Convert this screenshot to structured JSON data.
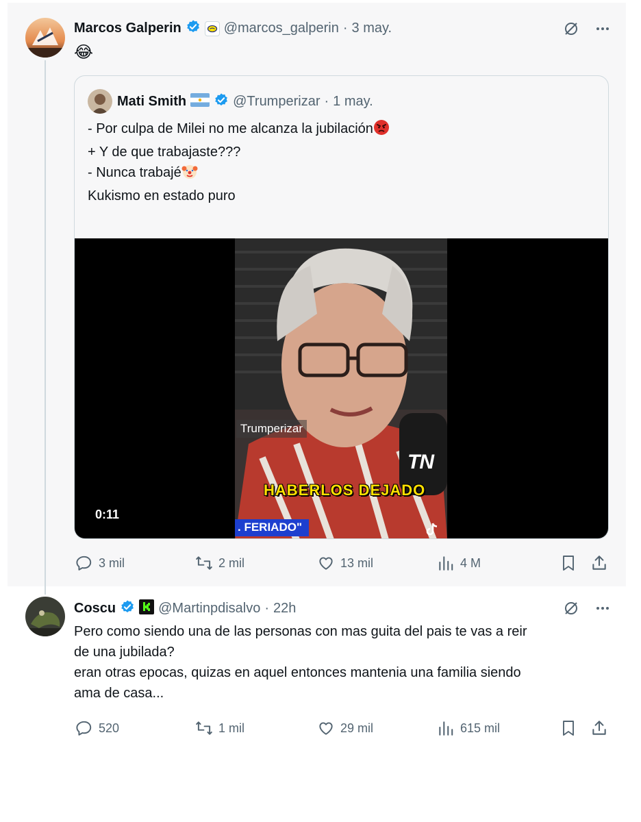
{
  "post": {
    "author": {
      "name": "Marcos Galperin",
      "handle": "@marcos_galperin",
      "time": "3 may."
    },
    "body_emoji": "😂",
    "quote": {
      "author": {
        "name": "Mati Smith",
        "handle": "@Trumperizar",
        "time": "1 may."
      },
      "lines": [
        "- Por culpa de Milei no me alcanza la jubilación",
        "+ Y de que trabajaste???",
        "- Nunca trabajé",
        "",
        "Kukismo en estado puro"
      ],
      "video": {
        "duration": "0:11",
        "watermark": "Trumperizar",
        "caption": "HABERLOS DEJADO",
        "ticker": ". FERIADO\"",
        "channel": "TN"
      }
    },
    "stats": {
      "replies": "3 mil",
      "reposts": "2 mil",
      "likes": "13 mil",
      "views": "4 M"
    }
  },
  "reply": {
    "author": {
      "name": "Coscu",
      "handle": "@Martinpdisalvo",
      "time": "22h"
    },
    "lines": [
      "Pero como siendo una de las personas con mas guita del pais te vas a reir",
      "de una jubilada?",
      "eran otras epocas, quizas en aquel entonces mantenia una familia siendo",
      "ama de casa..."
    ],
    "stats": {
      "replies": "520",
      "reposts": "1 mil",
      "likes": "29 mil",
      "views": "615 mil"
    }
  },
  "colors": {
    "verified": "#1d9bf0",
    "muted": "#536471",
    "text": "#0f1419",
    "border": "#cfd9de",
    "panel": "#f7f7f8"
  },
  "icons": [
    "verified-badge-icon",
    "grok-icon",
    "more-icon",
    "reply-icon",
    "repost-icon",
    "like-icon",
    "views-icon",
    "bookmark-icon",
    "share-icon",
    "tiktok-icon"
  ]
}
